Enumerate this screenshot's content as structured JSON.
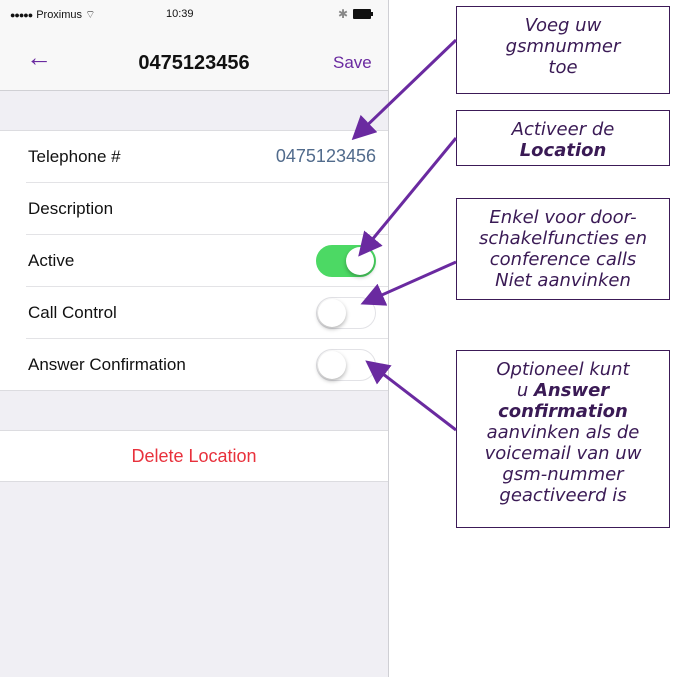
{
  "status_bar": {
    "carrier": "Proximus",
    "time": "10:39"
  },
  "nav": {
    "title": "0475123456",
    "save_label": "Save",
    "back_icon": "arrow-left-icon"
  },
  "fields": {
    "telephone_label": "Telephone #",
    "telephone_value": "0475123456",
    "description_label": "Description",
    "active_label": "Active",
    "active_on": true,
    "call_control_label": "Call Control",
    "call_control_on": false,
    "answer_confirmation_label": "Answer Confirmation",
    "answer_confirmation_on": false
  },
  "delete": {
    "label": "Delete Location",
    "color": "#e8313c"
  },
  "callouts": [
    {
      "lines": [
        "Voeg uw",
        "gsmnummer",
        "toe"
      ]
    },
    {
      "lines": [
        "Activeer de"
      ],
      "strong": "Location"
    },
    {
      "lines": [
        "Enkel voor door-",
        "schakelfuncties en",
        "conference calls",
        "Niet aanvinken"
      ]
    },
    {
      "lines": [
        "Optioneel kunt",
        "u"
      ],
      "strong_lines": [
        "Answer",
        "confirmation"
      ],
      "tail_lines": [
        "aanvinken als de",
        "voicemail van uw",
        "gsm-nummer",
        "geactiveerd is"
      ]
    }
  ],
  "accent_color": "#6a2aa0",
  "toggle_on_color": "#4cd964"
}
